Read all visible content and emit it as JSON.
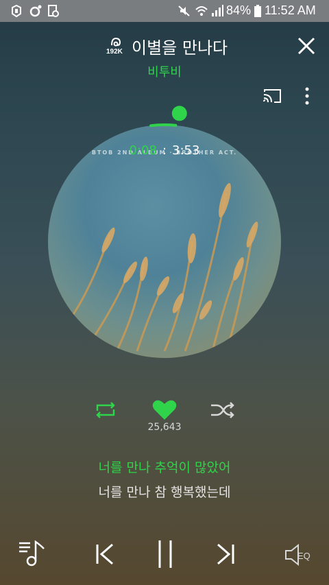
{
  "status_bar": {
    "battery": "84%",
    "time": "11:52 AM",
    "icons": [
      "app-icon-1",
      "app-icon-2",
      "app-icon-3",
      "mute-icon",
      "wifi-icon",
      "signal-icon",
      "battery-icon"
    ]
  },
  "player": {
    "quality_badge": "192K",
    "title": "이별을 만나다",
    "artist": "비투비",
    "album_text": "BTOB 2ND ALBUM · BROTHER ACT.",
    "time_current": "0:08",
    "time_separator": ":",
    "time_total": "3:53",
    "progress_fraction": 0.034,
    "like_count": "25,643",
    "liked": true
  },
  "lyrics": {
    "current": "너를 만나 추억이 많았어",
    "next": "너를 만나 참 행복했는데"
  },
  "controls": {
    "eq_label": "EQ"
  },
  "colors": {
    "accent": "#2fd44a",
    "status_bar": "#7a7d80"
  }
}
